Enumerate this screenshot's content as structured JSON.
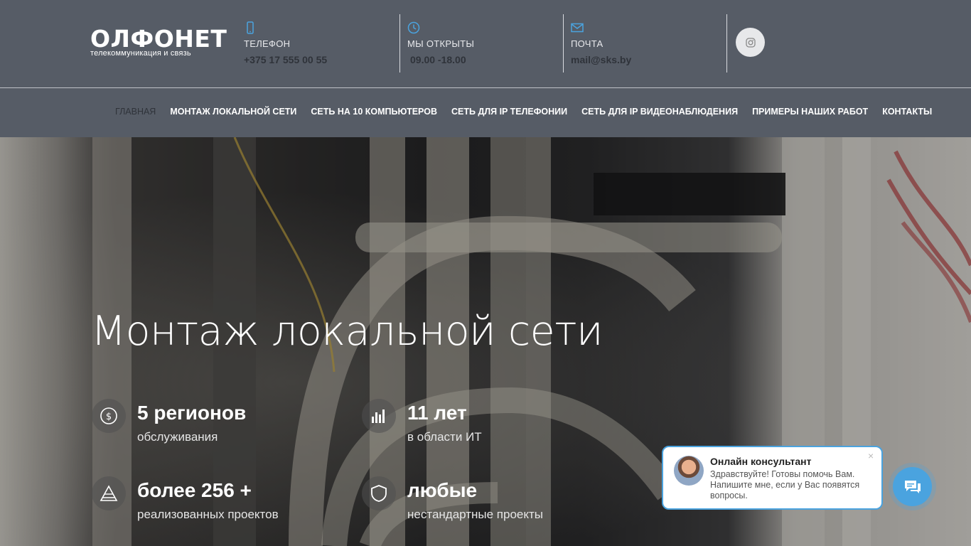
{
  "header": {
    "logo_main": "ОЛФОНЕТ",
    "logo_sub": "телекоммуникация и связь",
    "phone": {
      "icon": "phone-icon",
      "label": "ТЕЛЕФОН",
      "value": "+375 17 555 00 55"
    },
    "hours": {
      "icon": "clock-icon",
      "label": "МЫ ОТКРЫТЫ",
      "value": "09.00 -18.00"
    },
    "mail": {
      "icon": "mail-icon",
      "label": "ПОЧТА",
      "value": "mail@sks.by"
    },
    "social_icon": "instagram-icon"
  },
  "nav": {
    "items": [
      {
        "label": "ГЛАВНАЯ"
      },
      {
        "label": "МОНТАЖ ЛОКАЛЬНОЙ СЕТИ"
      },
      {
        "label": "СЕТЬ НА 10 КОМПЬЮТЕРОВ"
      },
      {
        "label": "СЕТЬ ДЛЯ IP ТЕЛЕФОНИИ"
      },
      {
        "label": "СЕТЬ ДЛЯ IP ВИДЕОНАБЛЮДЕНИЯ"
      },
      {
        "label": "ПРИМЕРЫ НАШИХ РАБОТ"
      },
      {
        "label": "КОНТАКТЫ"
      }
    ]
  },
  "hero": {
    "title": "Монтаж локальной сети",
    "stats": [
      {
        "icon": "globe-money-icon",
        "big": "5 регионов",
        "small": "обслуживания"
      },
      {
        "icon": "bar-levels-icon",
        "big": "11 лет",
        "small": "в области ИТ"
      },
      {
        "icon": "pyramid-icon",
        "big": "более 256 +",
        "small": "реализованных проектов"
      },
      {
        "icon": "shield-icon",
        "big": "любые",
        "small": "нестандартные проекты"
      }
    ]
  },
  "chat": {
    "title": "Онлайн консультант",
    "text": "Здравствуйте! Готовы помочь Вам. Напишите мне, если у Вас появятся вопросы.",
    "close": "×",
    "button_icon": "chat-bubbles-icon"
  },
  "colors": {
    "header_bg": "#565c66",
    "accent": "#4aa3df",
    "dark_text": "#2f333a"
  }
}
